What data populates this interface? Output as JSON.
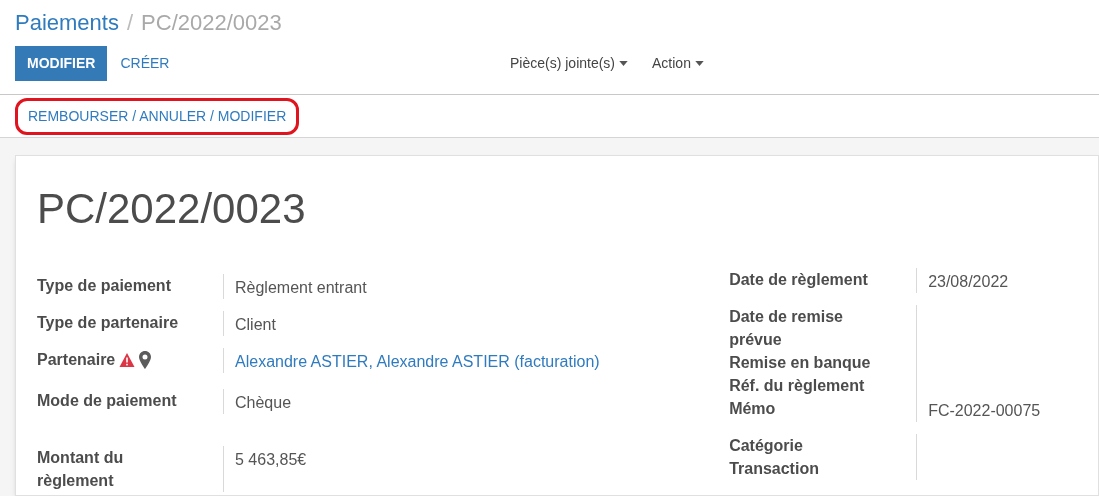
{
  "breadcrumb": [
    {
      "label": "Paiements",
      "kind": "link"
    },
    {
      "label": "/",
      "kind": "separator"
    },
    {
      "label": "PC/2022/0023",
      "kind": "current"
    }
  ],
  "buttons": [
    {
      "label": "MODIFIER",
      "kind": "primary"
    },
    {
      "label": "CRÉER",
      "kind": "link"
    }
  ],
  "dropdowns": [
    "Pièce(s) jointe(s)",
    "Action"
  ],
  "status_bar": {
    "action": "REMBOURSER / ANNULER / MODIFIER",
    "highlighted": true
  },
  "record": {
    "title": "PC/2022/0023",
    "left_fields": [
      {
        "label": "Type de paiement",
        "value": "Règlement entrant"
      },
      {
        "label": "Type de partenaire",
        "value": "Client"
      },
      {
        "label": "Partenaire",
        "value": "Alexandre ASTIER, Alexandre ASTIER (facturation)",
        "link": true,
        "warning": true,
        "location": true
      },
      {
        "label": "Mode de paiement",
        "value": "Chèque"
      },
      {
        "label": "Montant du règlement",
        "value": "5 463,85€"
      }
    ],
    "right_fields": [
      {
        "label": "Date de règlement",
        "value": "23/08/2022"
      },
      {
        "label": "Date de remise prévue"
      },
      {
        "label": "Remise en banque"
      },
      {
        "label": "Réf. du règlement"
      },
      {
        "label": "Mémo",
        "value": "FC-2022-00075"
      },
      {
        "label": "Catégorie"
      },
      {
        "label": "Transaction"
      }
    ]
  }
}
